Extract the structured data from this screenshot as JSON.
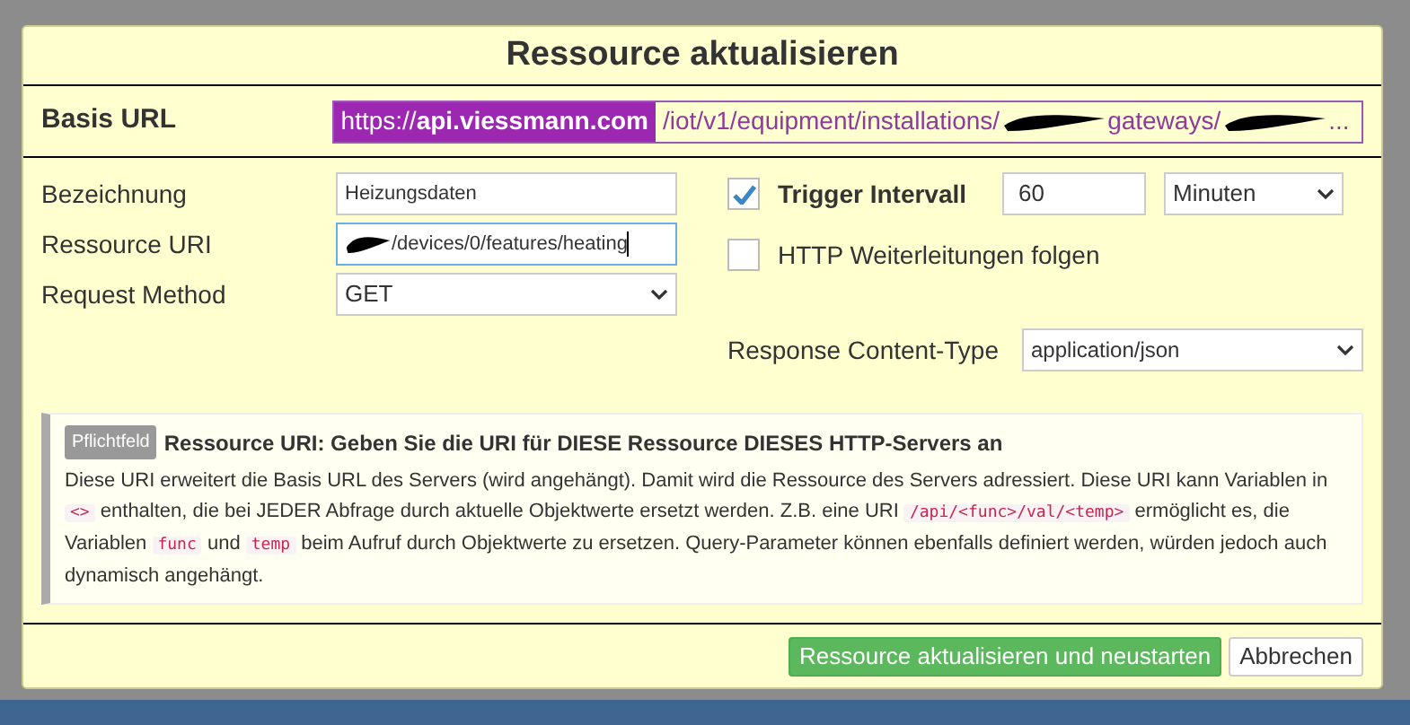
{
  "dialog": {
    "title": "Ressource aktualisieren",
    "base_url": {
      "label": "Basis URL",
      "host_prefix": "https://",
      "host": "api.viessmann.com",
      "path_parts": [
        "/iot/v1/equipment/installations/",
        "gateways/",
        "..."
      ]
    },
    "fields": [
      {
        "kind": "text",
        "label": "Bezeichnung",
        "value": "Heizungsdaten",
        "redacted": false,
        "focused": false
      },
      {
        "kind": "text",
        "label": "Ressource URI",
        "value": "/devices/0/features/heating",
        "redacted": true,
        "focused": true
      },
      {
        "kind": "select",
        "label": "Request Method",
        "value": "GET"
      }
    ],
    "trigger": {
      "label": "Trigger Intervall",
      "checked": true,
      "value": "60",
      "unit": "Minuten"
    },
    "redirect": {
      "label": "HTTP Weiterleitungen folgen",
      "checked": false
    },
    "content_type": {
      "label": "Response Content-Type",
      "value": "application/json"
    },
    "help": {
      "badge": "Pflichtfeld",
      "heading": "Ressource URI: Geben Sie die URI für DIESE Ressource DIESES HTTP-Servers an",
      "parts": [
        {
          "kind": "text",
          "text": "Diese URI erweitert die Basis URL des Servers (wird angehängt). Damit wird die Ressource des Servers adressiert. Diese URI kann Variablen in "
        },
        {
          "kind": "code",
          "text": "<>"
        },
        {
          "kind": "text",
          "text": " enthalten, die bei JEDER Abfrage durch aktuelle Objektwerte ersetzt werden. Z.B. eine URI "
        },
        {
          "kind": "code",
          "text": "/api/<func>/val/<temp>"
        },
        {
          "kind": "text",
          "text": " ermöglicht es, die Variablen "
        },
        {
          "kind": "code",
          "text": "func"
        },
        {
          "kind": "text",
          "text": " und "
        },
        {
          "kind": "code",
          "text": "temp"
        },
        {
          "kind": "text",
          "text": " beim Aufruf durch Objektwerte zu ersetzen. Query-Parameter können ebenfalls definiert werden, würden jedoch auch dynamisch angehängt."
        }
      ]
    },
    "buttons": [
      {
        "kind": "primary",
        "label": "Ressource aktualisieren und neustarten"
      },
      {
        "kind": "secondary",
        "label": "Abbrechen"
      }
    ]
  }
}
